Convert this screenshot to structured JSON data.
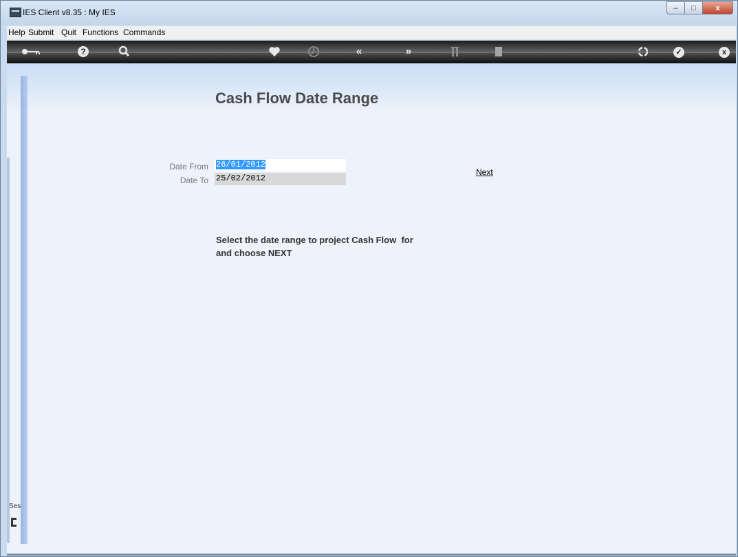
{
  "window": {
    "title": "IES Client v8.35 : My IES"
  },
  "menubar": {
    "items": [
      "Help",
      "Submit",
      "Quit",
      "Functions",
      "Commands"
    ]
  },
  "toolbar": {
    "icons": [
      "key-icon",
      "help-icon",
      "search-icon",
      "heart-icon",
      "clock-icon",
      "rewind-icon",
      "fast-forward-icon",
      "tools-icon",
      "document-icon",
      "recycle-icon",
      "checkmark-icon",
      "close-icon"
    ],
    "glyphs": {
      "help": "?",
      "rewind": "«",
      "fast_forward": "»",
      "check": "✓",
      "close": "x",
      "minimize": "–",
      "maximize": "□",
      "win_close": "x"
    }
  },
  "page": {
    "title": "Cash Flow Date Range",
    "date_from_label": "Date From",
    "date_from_value": "26/01/2012",
    "date_to_label": "Date To",
    "date_to_value": "25/02/2012",
    "next_label": "Next",
    "instructions_line1": "Select the date range to project Cash Flow  for",
    "instructions_line2": "and choose NEXT"
  },
  "sidebar": {
    "session_label": "Ses"
  },
  "colors": {
    "selection": "#3399ff",
    "content_bg": "#eef2fa",
    "toolbar_bg": "#1b1b1b"
  }
}
